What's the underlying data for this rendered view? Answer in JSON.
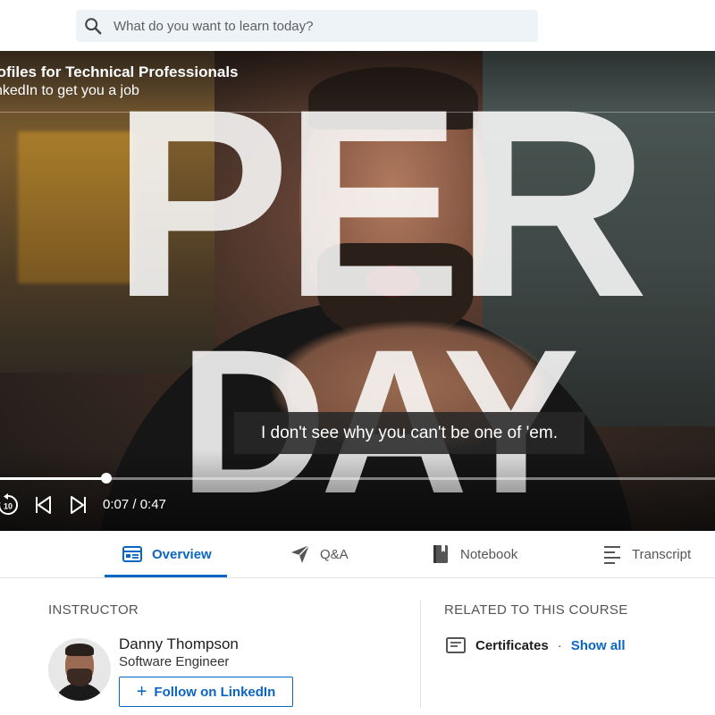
{
  "search": {
    "placeholder": "What do you want to learn today?"
  },
  "video": {
    "course_title": "rofiles for Technical Professionals",
    "subtitle": "nkedIn to get you a job",
    "overlay_word_1": "PER",
    "overlay_word_2": "DAY",
    "caption": "I don't see why you can't be one of 'em.",
    "time_display": "0:07 / 0:47",
    "progress_fraction": 0.149,
    "controls": {
      "rewind_label": "10"
    }
  },
  "tabs": [
    {
      "label": "Overview",
      "icon": "overview-icon",
      "active": true
    },
    {
      "label": "Q&A",
      "icon": "paper-plane-icon",
      "active": false
    },
    {
      "label": "Notebook",
      "icon": "notebook-icon",
      "active": false
    },
    {
      "label": "Transcript",
      "icon": "transcript-icon",
      "active": false
    }
  ],
  "instructor": {
    "section_label": "INSTRUCTOR",
    "name": "Danny Thompson",
    "title": "Software Engineer",
    "follow_label": "Follow on LinkedIn"
  },
  "related": {
    "section_label": "RELATED TO THIS COURSE",
    "item_label": "Certificates",
    "separator": "·",
    "show_all_label": "Show all"
  },
  "colors": {
    "accent": "#0a66c2",
    "search_bg": "#eef3f8"
  }
}
